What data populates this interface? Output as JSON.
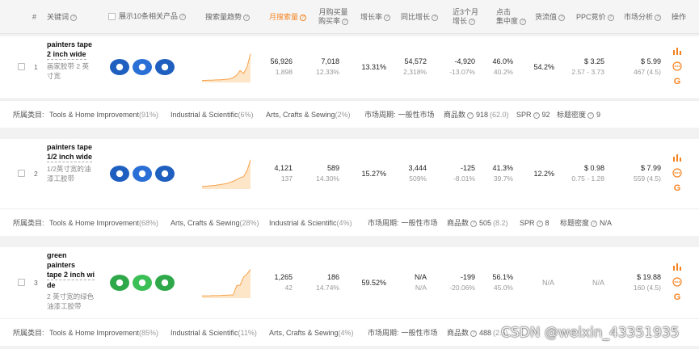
{
  "header": {
    "index": "#",
    "keyword": "关键词",
    "show_products": "展示10条相关产品",
    "trend": "搜索量趋势",
    "monthly_search": "月搜索量",
    "monthly_buy_1": "月购买量",
    "monthly_buy_2": "购买率",
    "growth": "增长率",
    "yoy": "同比增长",
    "three_month_1": "近3个月",
    "three_month_2": "增长",
    "click_1": "点击",
    "click_2": "集中度",
    "goods_flow": "货流值",
    "ppc": "PPC竞价",
    "market": "市场分析",
    "ops": "操作",
    "help_icon": "question-icon"
  },
  "rows": [
    {
      "index": "1",
      "kw_line1": "painters tape",
      "kw_line2": "2 inch wide",
      "kw_cn_1": "画家胶带 2 英",
      "kw_cn_2": "寸宽",
      "search": "56,926",
      "search_sub": "1,898",
      "buy": "7,018",
      "buy_sub": "12.33%",
      "growth": "13.31%",
      "yoy": "54,572",
      "yoy_sub": "2,318%",
      "m3": "-4,920",
      "m3_sub": "-13.07%",
      "click": "46.0%",
      "click_sub": "40.2%",
      "flow": "54.2%",
      "ppc": "$ 3.25",
      "ppc_sub": "2.57 - 3.73",
      "market": "$ 5.99",
      "market_sub": "467 (4.5)",
      "trend": [
        4,
        4,
        5,
        5,
        6,
        6,
        7,
        8,
        9,
        14,
        22,
        38,
        28,
        50,
        96
      ],
      "categories": [
        {
          "name": "Tools & Home Improvement",
          "pct": "(91%)"
        },
        {
          "name": "Industrial & Scientific",
          "pct": "(6%)"
        },
        {
          "name": "Arts, Crafts & Sewing",
          "pct": "(2%)"
        }
      ],
      "period_label": "市场周期:",
      "period_value": "一般性市场",
      "goods_label": "商品数",
      "goods_value": "918",
      "goods_sub": "(62.0)",
      "spr_label": "SPR",
      "spr_value": "92",
      "density_label": "标题密度",
      "density_value": "9"
    },
    {
      "index": "2",
      "kw_line1": "painters tape",
      "kw_line2": "1/2 inch wide",
      "kw_cn_1": "1/2英寸宽的油",
      "kw_cn_2": "漆工胶带",
      "search": "4,121",
      "search_sub": "137",
      "buy": "589",
      "buy_sub": "14.30%",
      "growth": "15.27%",
      "yoy": "3,444",
      "yoy_sub": "509%",
      "m3": "-125",
      "m3_sub": "-8.01%",
      "click": "41.3%",
      "click_sub": "39.7%",
      "flow": "12.2%",
      "ppc": "$ 0.98",
      "ppc_sub": "0.75 - 1.28",
      "market": "$ 7.99",
      "market_sub": "559 (4.5)",
      "trend": [
        6,
        7,
        8,
        9,
        10,
        12,
        14,
        16,
        20,
        24,
        30,
        36,
        40,
        60,
        98
      ],
      "categories": [
        {
          "name": "Tools & Home Improvement",
          "pct": "(68%)"
        },
        {
          "name": "Arts, Crafts & Sewing",
          "pct": "(28%)"
        },
        {
          "name": "Industrial & Scientific",
          "pct": "(4%)"
        }
      ],
      "period_label": "市场周期:",
      "period_value": "一般性市场",
      "goods_label": "商品数",
      "goods_value": "505",
      "goods_sub": "(8.2)",
      "spr_label": "SPR",
      "spr_value": "8",
      "density_label": "标题密度",
      "density_value": "N/A"
    },
    {
      "index": "3",
      "kw_line1": "green painters",
      "kw_line2": "tape 2 inch wi",
      "kw_line3": "de",
      "kw_cn_1": "2 英寸宽的绿色",
      "kw_cn_2": "油漆工胶带",
      "search": "1,265",
      "search_sub": "42",
      "buy": "186",
      "buy_sub": "14.74%",
      "growth": "59.52%",
      "yoy": "N/A",
      "yoy_sub": "N/A",
      "m3": "-199",
      "m3_sub": "-20.06%",
      "click": "56.1%",
      "click_sub": "45.0%",
      "flow": "N/A",
      "ppc": "N/A",
      "ppc_sub": "",
      "market": "$ 19.88",
      "market_sub": "160 (4.5)",
      "trend": [
        5,
        5,
        5,
        6,
        6,
        6,
        7,
        7,
        8,
        8,
        40,
        42,
        70,
        80,
        96
      ],
      "categories": [
        {
          "name": "Tools & Home Improvement",
          "pct": "(85%)"
        },
        {
          "name": "Industrial & Scientific",
          "pct": "(11%)"
        },
        {
          "name": "Arts, Crafts & Sewing",
          "pct": "(4%)"
        }
      ],
      "period_label": "市场周期:",
      "period_value": "一般性市场",
      "goods_label": "商品数",
      "goods_value": "488",
      "goods_sub": "(2.6)"
    }
  ],
  "cat_label": "所属类目:",
  "watermark": "CSDN @weixin_43351935",
  "colors": {
    "accent": "#f5821f",
    "trend": "#f7a24b",
    "google_red": "#e53935"
  }
}
